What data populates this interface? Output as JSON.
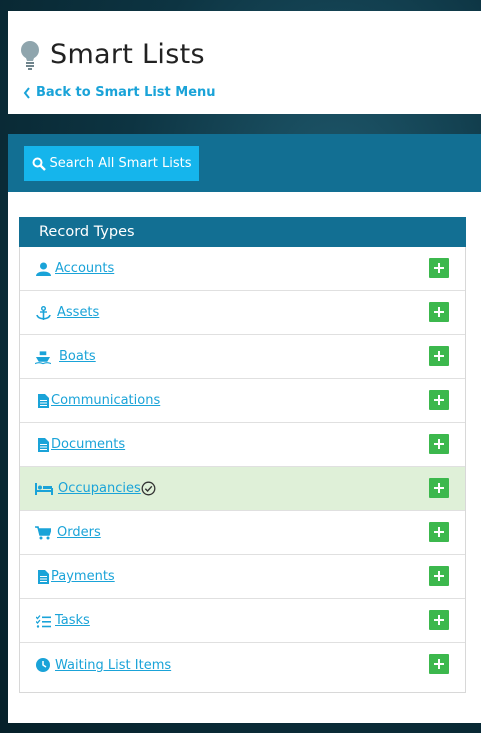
{
  "header": {
    "title": "Smart Lists",
    "back_link": "Back to Smart List Menu"
  },
  "toolbar": {
    "search_label": "Search All Smart Lists"
  },
  "record_types": {
    "heading": "Record Types",
    "items": [
      {
        "label": "Accounts",
        "icon": "user-icon"
      },
      {
        "label": "Assets",
        "icon": "anchor-icon"
      },
      {
        "label": "Boats",
        "icon": "boat-icon"
      },
      {
        "label": "Communications",
        "icon": "document-icon"
      },
      {
        "label": "Documents",
        "icon": "document-icon"
      },
      {
        "label": "Occupancies",
        "icon": "bed-icon",
        "selected": true
      },
      {
        "label": "Orders",
        "icon": "cart-icon"
      },
      {
        "label": "Payments",
        "icon": "document-icon"
      },
      {
        "label": "Tasks",
        "icon": "checklist-icon"
      },
      {
        "label": "Waiting List Items",
        "icon": "clock-icon"
      }
    ]
  },
  "colors": {
    "accent": "#1aa3d8",
    "header_bar": "#126f93",
    "search_button": "#15b5ec",
    "add_button": "#3cb84d",
    "selected_row": "#dff0d8"
  }
}
